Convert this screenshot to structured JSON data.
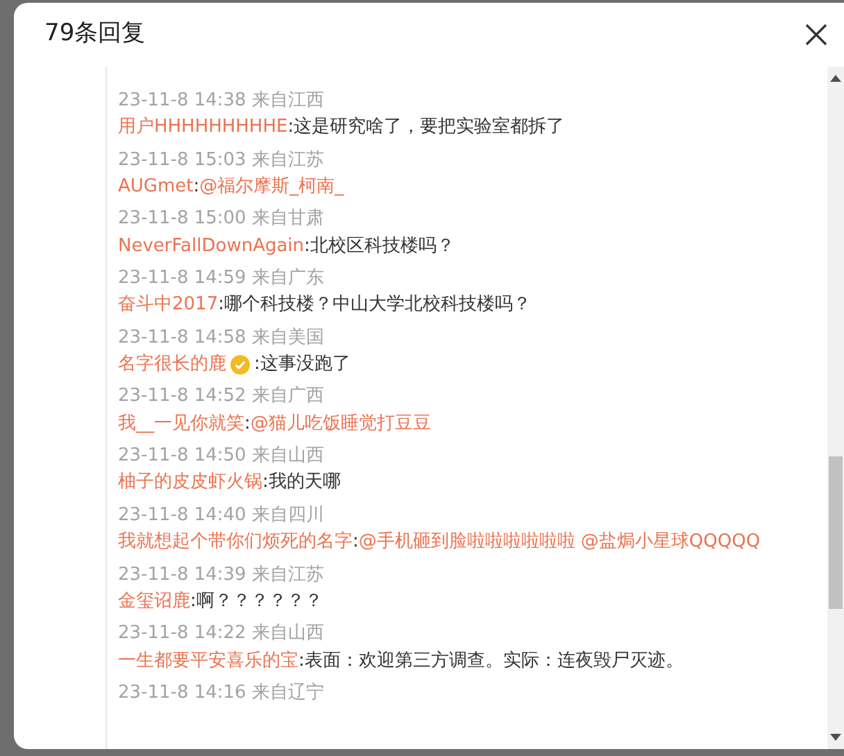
{
  "dialog": {
    "title": "79条回复"
  },
  "lines": [
    {
      "kind": "time",
      "text": "23-11-8 14:38 来自江西"
    },
    {
      "kind": "comment",
      "user": "用户HHHHHHHHHE",
      "verified": false,
      "segments": [
        {
          "kind": "text",
          "text": ":这是研究啥了，要把实验室都拆了"
        }
      ]
    },
    {
      "kind": "time",
      "text": "23-11-8 15:03 来自江苏"
    },
    {
      "kind": "comment",
      "user": "AUGmet",
      "verified": false,
      "segments": [
        {
          "kind": "text",
          "text": ":"
        },
        {
          "kind": "mention",
          "text": "@福尔摩斯_柯南_"
        }
      ]
    },
    {
      "kind": "time",
      "text": "23-11-8 15:00 来自甘肃"
    },
    {
      "kind": "comment",
      "user": "NeverFallDownAgain",
      "verified": false,
      "segments": [
        {
          "kind": "text",
          "text": ":北校区科技楼吗？"
        }
      ]
    },
    {
      "kind": "time",
      "text": "23-11-8 14:59 来自广东"
    },
    {
      "kind": "comment",
      "user": "奋斗中2017",
      "verified": false,
      "segments": [
        {
          "kind": "text",
          "text": ":哪个科技楼？中山大学北校科技楼吗？"
        }
      ]
    },
    {
      "kind": "time",
      "text": "23-11-8 14:58 来自美国"
    },
    {
      "kind": "comment",
      "user": "名字很长的鹿",
      "verified": true,
      "segments": [
        {
          "kind": "text",
          "text": ":这事没跑了"
        }
      ]
    },
    {
      "kind": "time",
      "text": "23-11-8 14:52 来自广西"
    },
    {
      "kind": "comment",
      "user": "我__一见你就笑",
      "verified": false,
      "segments": [
        {
          "kind": "text",
          "text": ":"
        },
        {
          "kind": "mention",
          "text": "@猫儿吃饭睡觉打豆豆"
        }
      ]
    },
    {
      "kind": "time",
      "text": "23-11-8 14:50 来自山西"
    },
    {
      "kind": "comment",
      "user": "柚子的皮皮虾火锅",
      "verified": false,
      "segments": [
        {
          "kind": "text",
          "text": ":我的天哪"
        }
      ]
    },
    {
      "kind": "time",
      "text": "23-11-8 14:40 来自四川"
    },
    {
      "kind": "comment",
      "user": "我就想起个带你们烦死的名字",
      "verified": false,
      "segments": [
        {
          "kind": "text",
          "text": ":"
        },
        {
          "kind": "mention",
          "text": "@手机砸到脸啦啦啦啦啦啦"
        },
        {
          "kind": "mention",
          "text": "@盐焗小星球QQQQQ"
        }
      ]
    },
    {
      "kind": "time",
      "text": "23-11-8 14:39 来自江苏"
    },
    {
      "kind": "comment",
      "user": "金玺诏鹿",
      "verified": false,
      "segments": [
        {
          "kind": "text",
          "text": ":啊？？？？？？"
        }
      ]
    },
    {
      "kind": "time",
      "text": "23-11-8 14:22 来自山西"
    },
    {
      "kind": "comment",
      "user": "一生都要平安喜乐的宝",
      "verified": false,
      "segments": [
        {
          "kind": "text",
          "text": ":表面：欢迎第三方调查。实际：连夜毁尸灭迹。"
        }
      ]
    },
    {
      "kind": "time",
      "text": "23-11-8 14:16 来自辽宁"
    }
  ]
}
